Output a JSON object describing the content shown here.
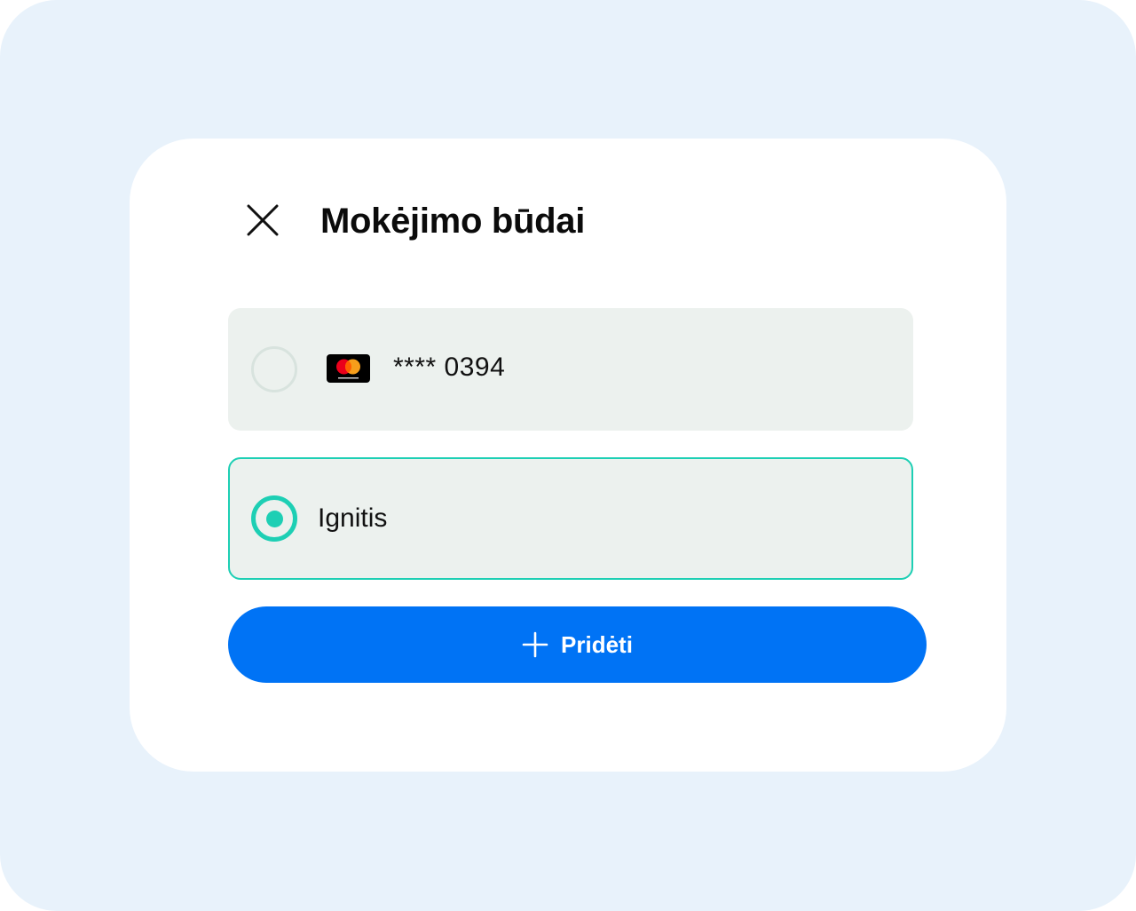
{
  "header": {
    "title": "Mokėjimo būdai",
    "close_icon": "close-icon"
  },
  "payment_methods": [
    {
      "label": "**** 0394",
      "brand": "mastercard",
      "brand_icon": "mastercard-icon",
      "selected": false
    },
    {
      "label": "Ignitis",
      "selected": true
    }
  ],
  "actions": {
    "add_label": "Pridėti",
    "add_icon": "plus-icon"
  },
  "colors": {
    "backdrop": "#e8f2fb",
    "dialog": "#ffffff",
    "option_bg": "#ecf1ee",
    "accent": "#1dcfb4",
    "primary_button": "#0073f5",
    "text": "#0b0b0b"
  }
}
